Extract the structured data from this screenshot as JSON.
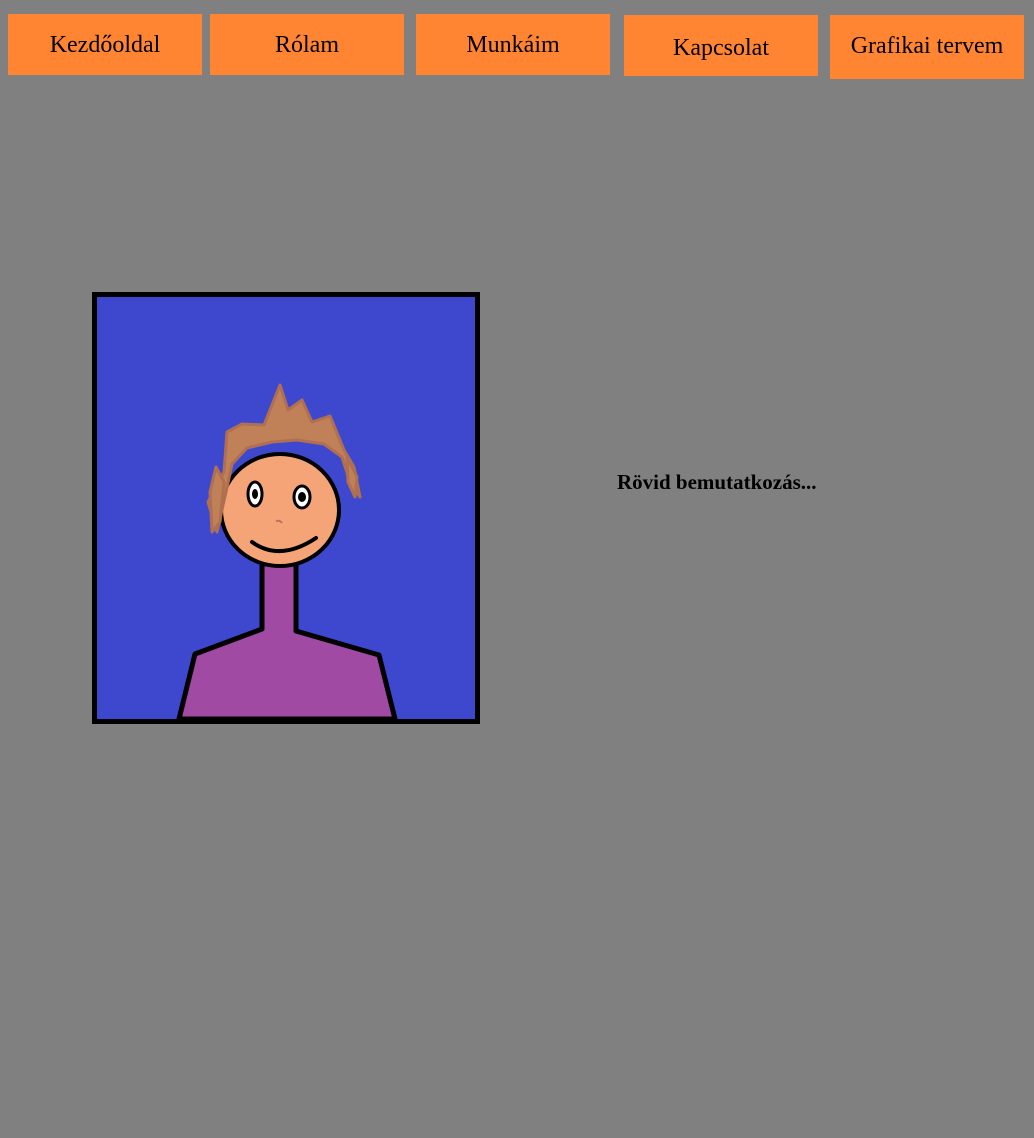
{
  "nav": {
    "items": [
      {
        "label": "Kezdőoldal"
      },
      {
        "label": "Rólam"
      },
      {
        "label": "Munkáim"
      },
      {
        "label": "Kapcsolat"
      },
      {
        "label": "Grafikai tervem"
      }
    ]
  },
  "main": {
    "intro_text": "Rövid bemutatkozás..."
  },
  "colors": {
    "background": "#808080",
    "nav_button": "#ff8533",
    "portrait_background": "#3e48cf",
    "shirt": "#a04aa3",
    "skin": "#f5a477",
    "hair": "#c08058"
  }
}
